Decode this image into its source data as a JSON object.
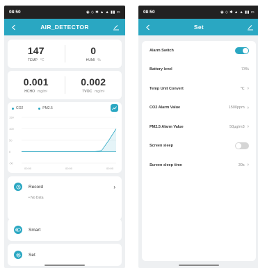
{
  "status": {
    "time": "08:50",
    "icons": "◉ ◇ ✱ ▲ ▲ ▮▮ ▭"
  },
  "colors": {
    "accent": "#2aa7c2",
    "background": "#eef0f2"
  },
  "left": {
    "title": "AIR_DETECTOR",
    "temp": {
      "value": "147",
      "label": "TEMP",
      "unit": "°C"
    },
    "humi": {
      "value": "0",
      "label": "HUMI",
      "unit": "%"
    },
    "hcho": {
      "value": "0.001",
      "label": "HCHO",
      "unit": "mg/m³"
    },
    "tvoc": {
      "value": "0.002",
      "label": "TVOC",
      "unit": "mg/m³"
    },
    "menu": {
      "record": "Record",
      "no_data": "• No Data",
      "smart": "Smart",
      "set": "Set"
    }
  },
  "chart_data": {
    "type": "line",
    "legend": [
      "CO2",
      "PM2.5"
    ],
    "yticks": [
      "150",
      "100",
      "50",
      "0",
      "-50"
    ],
    "xticks": [
      "00:00",
      "00:00",
      "00:00"
    ],
    "ylim": [
      -50,
      150
    ],
    "series": [
      {
        "name": "CO2",
        "values": [
          0,
          0,
          0,
          0,
          0,
          0,
          0,
          0,
          0,
          0,
          0,
          5,
          50,
          100
        ]
      },
      {
        "name": "PM2.5",
        "values": [
          0,
          0,
          0,
          0,
          0,
          0,
          0,
          0,
          0,
          0,
          0,
          0,
          0,
          0
        ]
      }
    ]
  },
  "right": {
    "title": "Set",
    "rows": [
      {
        "label": "Alarm Switch",
        "type": "toggle",
        "on": true
      },
      {
        "label": "Battery level",
        "type": "text",
        "value": "73%"
      },
      {
        "label": "Temp Unit Convert",
        "type": "nav",
        "value": "℃"
      },
      {
        "label": "CO2 Alarm Value",
        "type": "nav",
        "value": "1500ppm"
      },
      {
        "label": "PM2.5 Alarm Value",
        "type": "nav",
        "value": "50μg/m3"
      },
      {
        "label": "Screen sleep",
        "type": "toggle",
        "on": false
      },
      {
        "label": "Screen sleep time",
        "type": "nav",
        "value": "30s"
      }
    ]
  }
}
